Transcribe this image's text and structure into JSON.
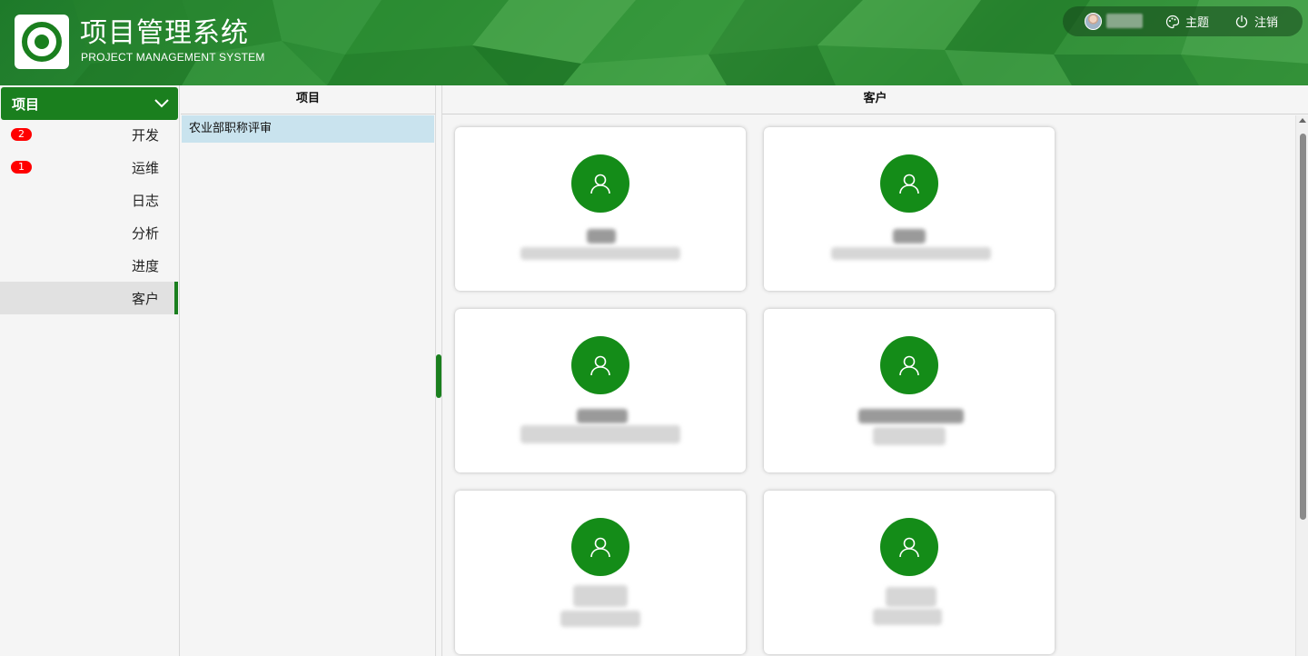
{
  "header": {
    "title": "项目管理系统",
    "subtitle": "PROJECT MANAGEMENT SYSTEM",
    "actions": [
      {
        "label": "主题",
        "icon": "palette-icon"
      },
      {
        "label": "注销",
        "icon": "power-icon"
      }
    ]
  },
  "sidebar": {
    "section": "项目",
    "items": [
      {
        "label": "开发",
        "badge": "2"
      },
      {
        "label": "运维",
        "badge": "1"
      },
      {
        "label": "日志",
        "badge": ""
      },
      {
        "label": "分析",
        "badge": ""
      },
      {
        "label": "进度",
        "badge": ""
      },
      {
        "label": "客户",
        "badge": "",
        "active": true
      }
    ]
  },
  "project_panel": {
    "title": "项目",
    "items": [
      "农业部职称评审"
    ]
  },
  "customer_panel": {
    "title": "客户"
  },
  "colors": {
    "accent": "#1a7f1e",
    "badge": "#ff0000",
    "selected_row": "#c9e3ee"
  }
}
